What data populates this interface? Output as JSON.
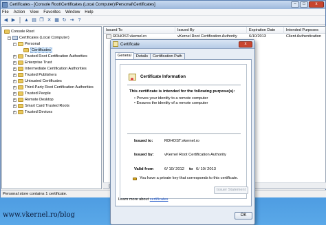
{
  "window": {
    "title": "Certificates - [Console Root\\Certificates (Local Computer)\\Personal\\Certificates]"
  },
  "menu": [
    "File",
    "Action",
    "View",
    "Favorites",
    "Window",
    "Help"
  ],
  "tree": {
    "root": "Console Root",
    "computer": "Certificates (Local Computer)",
    "personal": "Personal",
    "personal_child": "Certificates",
    "stores": [
      "Trusted Root Certification Authorities",
      "Enterprise Trust",
      "Intermediate Certification Authorities",
      "Trusted Publishers",
      "Untrusted Certificates",
      "Third-Party Root Certification Authorities",
      "Trusted People",
      "Remote Desktop",
      "Smart Card Trusted Roots",
      "Trusted Devices"
    ]
  },
  "list": {
    "columns": [
      "Issued To",
      "Issued By",
      "Expiration Date",
      "Intended Purposes"
    ],
    "rows": [
      {
        "issued_to": "RDHOST.vkernel.ro",
        "issued_by": "vKernel Root Certification Authority",
        "expiration": "6/10/2013",
        "purposes": "Client Authentication"
      }
    ]
  },
  "status": "Personal store contains 1 certificate.",
  "dialog": {
    "title": "Certificate",
    "close_label": "x",
    "tabs": [
      "General",
      "Details",
      "Certification Path"
    ],
    "info_title": "Certificate Information",
    "purpose_heading": "This certificate is intended for the following purpose(s):",
    "purposes": [
      "• Proves your identity to a remote computer",
      "• Ensures the identity of a remote computer"
    ],
    "issued_to_label": "Issued to:",
    "issued_to_value": "RDHOST.vkernel.ro",
    "issued_by_label": "Issued by:",
    "issued_by_value": "vKernel Root Certification Authority",
    "valid_from_label": "Valid from",
    "valid_from_value": "6/ 10/ 2012",
    "to_label": "to",
    "valid_to_value": "6/ 10/ 2013",
    "private_key_text": "You have a private key that corresponds to this certificate.",
    "issuer_statement_button": "Issuer Statement",
    "learn_more_prefix": "Learn more about",
    "learn_more_link": "certificates",
    "ok_button": "OK"
  },
  "watermark": "www.vkernel.ro/blog"
}
